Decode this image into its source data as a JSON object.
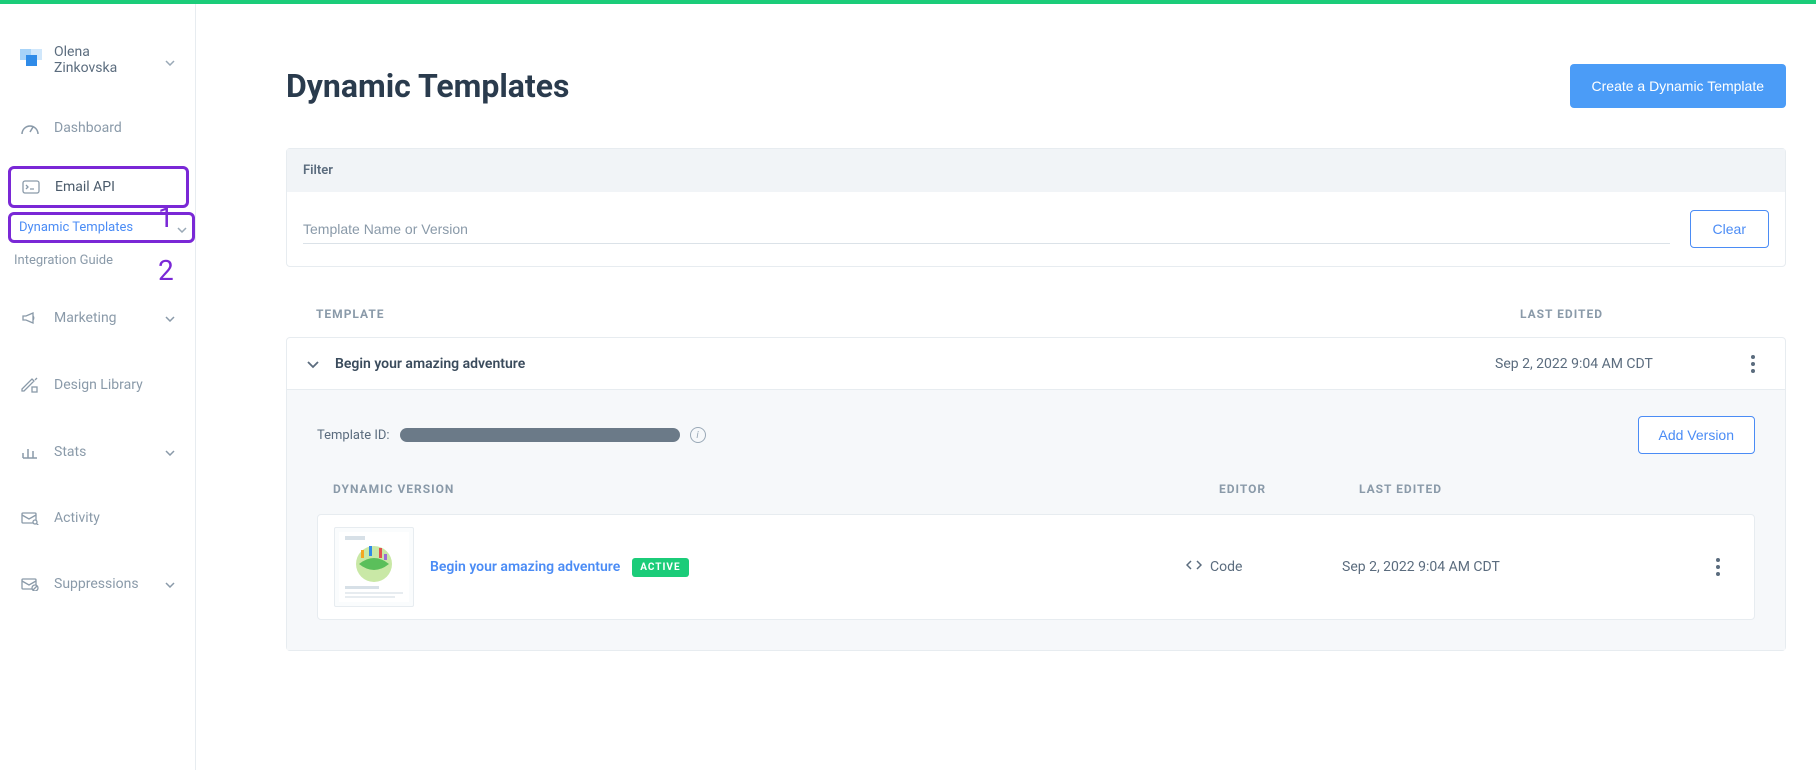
{
  "user": {
    "name": "Olena Zinkovska"
  },
  "annotations": {
    "one": "1",
    "two": "2"
  },
  "nav": {
    "dashboard": "Dashboard",
    "emailApi": "Email API",
    "dynamicTemplates": "Dynamic Templates",
    "integrationGuide": "Integration Guide",
    "marketing": "Marketing",
    "designLibrary": "Design Library",
    "stats": "Stats",
    "activity": "Activity",
    "suppressions": "Suppressions"
  },
  "header": {
    "title": "Dynamic Templates",
    "createBtn": "Create a Dynamic Template"
  },
  "filter": {
    "label": "Filter",
    "placeholder": "Template Name or Version",
    "clear": "Clear"
  },
  "tableHeaders": {
    "template": "TEMPLATE",
    "lastEdited": "LAST EDITED"
  },
  "template": {
    "name": "Begin your amazing adventure",
    "lastEdited": "Sep 2, 2022 9:04 AM CDT",
    "idLabel": "Template ID:",
    "addVersion": "Add Version"
  },
  "versionHeaders": {
    "name": "DYNAMIC VERSION",
    "editor": "EDITOR",
    "lastEdited": "LAST EDITED"
  },
  "version": {
    "name": "Begin your amazing adventure",
    "badge": "ACTIVE",
    "editor": "Code",
    "lastEdited": "Sep 2, 2022 9:04 AM CDT"
  }
}
